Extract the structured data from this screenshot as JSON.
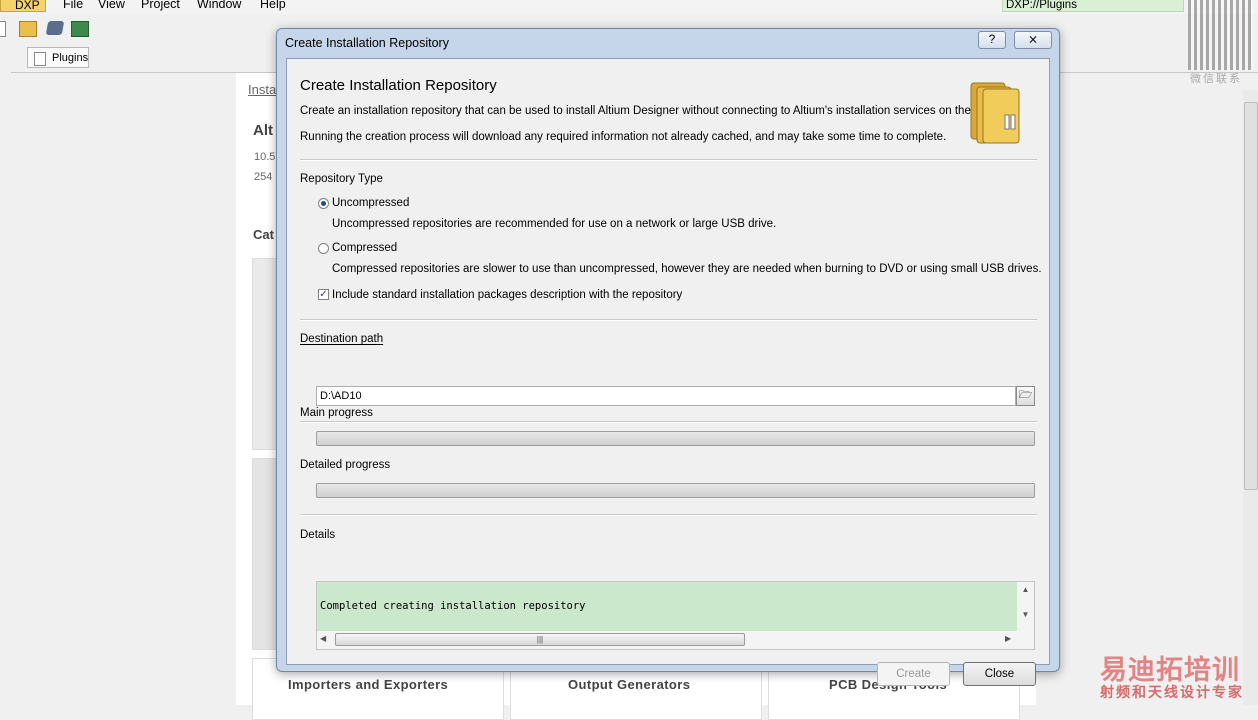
{
  "app": {
    "menu": {
      "dxp_label": "DXP",
      "file": "File",
      "view": "View",
      "project": "Project",
      "window": "Window",
      "help": "Help"
    },
    "address": "DXP://Plugins",
    "tab": "Plugins"
  },
  "background_page": {
    "breadcrumb": "Insta",
    "title": "Alt",
    "line1": "10.5",
    "line2": "254",
    "section": "Cat",
    "cards": [
      "Importers and Exporters",
      "Output Generators",
      "PCB Design Tools"
    ]
  },
  "watermark": {
    "qr_text": "微信联系",
    "title": "易迪拓培训",
    "subtitle": "射频和天线设计专家"
  },
  "dialog": {
    "window_title": "Create Installation Repository",
    "help_glyph": "?",
    "close_glyph": "⨯",
    "heading": "Create Installation Repository",
    "intro1": "Create an installation repository that can be used to install Altium Designer without connecting to Altium's installation services on the internet.",
    "intro2": "Running the creation process will download any required information not already cached, and may take some time to complete.",
    "repository_type_label": "Repository Type",
    "option_uncompressed": "Uncompressed",
    "option_uncompressed_desc": "Uncompressed repositories are recommended for use on a network or large USB drive.",
    "option_compressed": "Compressed",
    "option_compressed_desc": "Compressed repositories are slower to use than uncompressed, however they are needed when burning to DVD or using small USB drives.",
    "selected_type": "Uncompressed",
    "include_desc_label": "Include standard installation packages description with the repository",
    "include_desc_checked": true,
    "destination_label": "Destination path",
    "destination_value": "D:\\AD10",
    "main_progress_label": "Main progress",
    "main_progress": 0,
    "detailed_progress_label": "Detailed progress",
    "detailed_progress": 0,
    "details_label": "Details",
    "details_text": "Completed creating installation repository",
    "create_button": "Create",
    "close_button": "Close"
  }
}
